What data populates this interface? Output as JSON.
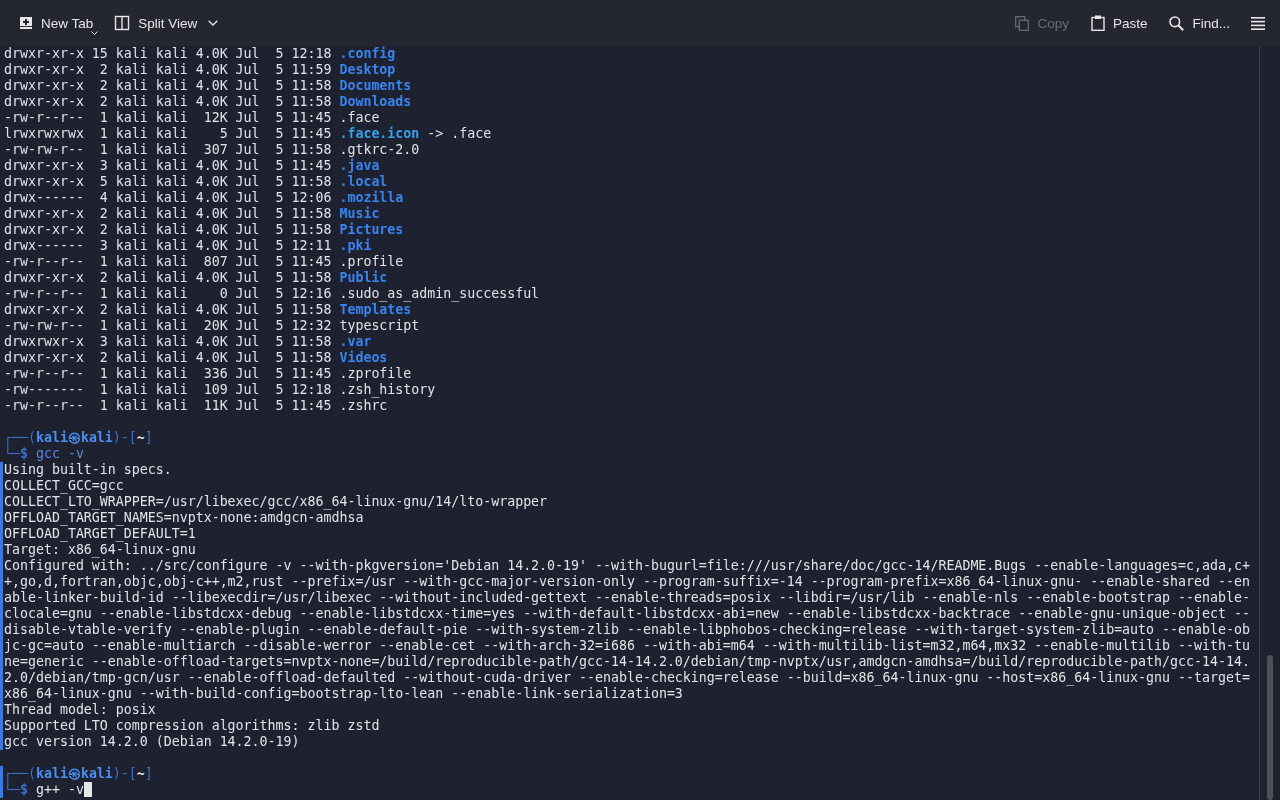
{
  "toolbar": {
    "new_tab": {
      "label": "New Tab"
    },
    "split_view": {
      "label": "Split View"
    },
    "actions": [
      {
        "kind": "copy",
        "label": "Copy",
        "disabled": true
      },
      {
        "kind": "paste",
        "label": "Paste",
        "disabled": false
      },
      {
        "kind": "find",
        "label": "Find...",
        "disabled": false
      }
    ]
  },
  "terminal": {
    "listing": [
      {
        "details": "drwxr-xr-x 15 kali kali 4.0K Jul  5 12:18",
        "name": ".config",
        "kind": "dir"
      },
      {
        "details": "drwxr-xr-x  2 kali kali 4.0K Jul  5 11:59",
        "name": "Desktop",
        "kind": "dir"
      },
      {
        "details": "drwxr-xr-x  2 kali kali 4.0K Jul  5 11:58",
        "name": "Documents",
        "kind": "dir"
      },
      {
        "details": "drwxr-xr-x  2 kali kali 4.0K Jul  5 11:58",
        "name": "Downloads",
        "kind": "dir"
      },
      {
        "details": "-rw-r--r--  1 kali kali  12K Jul  5 11:45",
        "name": ".face",
        "kind": "file"
      },
      {
        "details": "lrwxrwxrwx  1 kali kali    5 Jul  5 11:45",
        "name": ".face.icon",
        "kind": "link",
        "link_target": "-> .face"
      },
      {
        "details": "-rw-rw-r--  1 kali kali  307 Jul  5 11:58",
        "name": ".gtkrc-2.0",
        "kind": "file"
      },
      {
        "details": "drwxr-xr-x  3 kali kali 4.0K Jul  5 11:45",
        "name": ".java",
        "kind": "dir"
      },
      {
        "details": "drwxr-xr-x  5 kali kali 4.0K Jul  5 11:58",
        "name": ".local",
        "kind": "dir"
      },
      {
        "details": "drwx------  4 kali kali 4.0K Jul  5 12:06",
        "name": ".mozilla",
        "kind": "dir"
      },
      {
        "details": "drwxr-xr-x  2 kali kali 4.0K Jul  5 11:58",
        "name": "Music",
        "kind": "dir"
      },
      {
        "details": "drwxr-xr-x  2 kali kali 4.0K Jul  5 11:58",
        "name": "Pictures",
        "kind": "dir"
      },
      {
        "details": "drwx------  3 kali kali 4.0K Jul  5 12:11",
        "name": ".pki",
        "kind": "dir"
      },
      {
        "details": "-rw-r--r--  1 kali kali  807 Jul  5 11:45",
        "name": ".profile",
        "kind": "file"
      },
      {
        "details": "drwxr-xr-x  2 kali kali 4.0K Jul  5 11:58",
        "name": "Public",
        "kind": "dir"
      },
      {
        "details": "-rw-r--r--  1 kali kali    0 Jul  5 12:16",
        "name": ".sudo_as_admin_successful",
        "kind": "file"
      },
      {
        "details": "drwxr-xr-x  2 kali kali 4.0K Jul  5 11:58",
        "name": "Templates",
        "kind": "dir"
      },
      {
        "details": "-rw-rw-r--  1 kali kali  20K Jul  5 12:32",
        "name": "typescript",
        "kind": "file"
      },
      {
        "details": "drwxrwxr-x  3 kali kali 4.0K Jul  5 11:58",
        "name": ".var",
        "kind": "dir"
      },
      {
        "details": "drwxr-xr-x  2 kali kali 4.0K Jul  5 11:58",
        "name": "Videos",
        "kind": "dir"
      },
      {
        "details": "-rw-r--r--  1 kali kali  336 Jul  5 11:45",
        "name": ".zprofile",
        "kind": "file"
      },
      {
        "details": "-rw-------  1 kali kali  109 Jul  5 12:18",
        "name": ".zsh_history",
        "kind": "file"
      },
      {
        "details": "-rw-r--r--  1 kali kali  11K Jul  5 11:45",
        "name": ".zshrc",
        "kind": "file"
      }
    ],
    "sessions": [
      {
        "prompt_top": [
          {
            "kind": "frame",
            "text": "┌──("
          },
          {
            "kind": "user",
            "text": "kali㉿kali"
          },
          {
            "kind": "frame",
            "text": ")-["
          },
          {
            "kind": "dir",
            "text": "~"
          },
          {
            "kind": "frame",
            "text": "]"
          }
        ],
        "prompt_symbol": "└─$",
        "command": "gcc -v",
        "cursor": false,
        "output": [
          "Using built-in specs.",
          "COLLECT_GCC=gcc",
          "COLLECT_LTO_WRAPPER=/usr/libexec/gcc/x86_64-linux-gnu/14/lto-wrapper",
          "OFFLOAD_TARGET_NAMES=nvptx-none:amdgcn-amdhsa",
          "OFFLOAD_TARGET_DEFAULT=1",
          "Target: x86_64-linux-gnu",
          "Configured with: ../src/configure -v --with-pkgversion='Debian 14.2.0-19' --with-bugurl=file:///usr/share/doc/gcc-14/README.Bugs --enable-languages=c,ada,c++,go,d,fortran,objc,obj-c++,m2,rust --prefix=/usr --with-gcc-major-version-only --program-suffix=-14 --program-prefix=x86_64-linux-gnu- --enable-shared --enable-linker-build-id --libexecdir=/usr/libexec --without-included-gettext --enable-threads=posix --libdir=/usr/lib --enable-nls --enable-bootstrap --enable-clocale=gnu --enable-libstdcxx-debug --enable-libstdcxx-time=yes --with-default-libstdcxx-abi=new --enable-libstdcxx-backtrace --enable-gnu-unique-object --disable-vtable-verify --enable-plugin --enable-default-pie --with-system-zlib --enable-libphobos-checking=release --with-target-system-zlib=auto --enable-objc-gc=auto --enable-multiarch --disable-werror --enable-cet --with-arch-32=i686 --with-abi=m64 --with-multilib-list=m32,m64,mx32 --enable-multilib --with-tune=generic --enable-offload-targets=nvptx-none=/build/reproducible-path/gcc-14-14.2.0/debian/tmp-nvptx/usr,amdgcn-amdhsa=/build/reproducible-path/gcc-14-14.2.0/debian/tmp-gcn/usr --enable-offload-defaulted --without-cuda-driver --enable-checking=release --build=x86_64-linux-gnu --host=x86_64-linux-gnu --target=x86_64-linux-gnu --with-build-config=bootstrap-lto-lean --enable-link-serialization=3",
          "Thread model: posix",
          "Supported LTO compression algorithms: zlib zstd",
          "gcc version 14.2.0 (Debian 14.2.0-19)"
        ]
      },
      {
        "prompt_top": [
          {
            "kind": "frame",
            "text": "┌──("
          },
          {
            "kind": "user",
            "text": "kali㉿kali"
          },
          {
            "kind": "frame",
            "text": ")-["
          },
          {
            "kind": "dir",
            "text": "~"
          },
          {
            "kind": "frame",
            "text": "]"
          }
        ],
        "prompt_symbol": "└─$",
        "command": "g++ -v",
        "cursor": true
      }
    ]
  }
}
